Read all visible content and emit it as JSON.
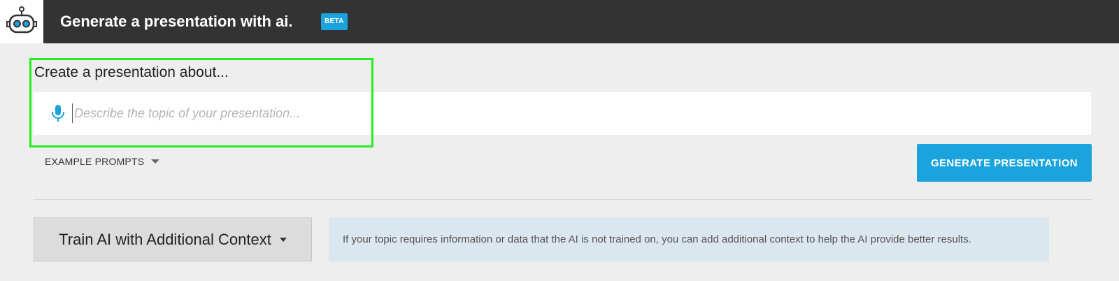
{
  "header": {
    "title": "Generate a presentation with ai.",
    "badge": "BETA",
    "logo_icon": "robot-icon"
  },
  "prompt": {
    "label": "Create a presentation about...",
    "mic_icon": "microphone-icon",
    "value": "",
    "placeholder": "Describe the topic of your presentation..."
  },
  "examples": {
    "label": "EXAMPLE PROMPTS",
    "icon": "chevron-down-icon"
  },
  "generate": {
    "label": "GENERATE PRESENTATION"
  },
  "context": {
    "button_label": "Train AI with Additional Context",
    "info": "If your topic requires information or data that the AI is not trained on, you can add additional context to help the AI provide better results."
  },
  "colors": {
    "accent": "#1aa3dc",
    "header_bg": "#333333",
    "highlight": "#22ee22",
    "info_bg": "#dbe7ee"
  }
}
